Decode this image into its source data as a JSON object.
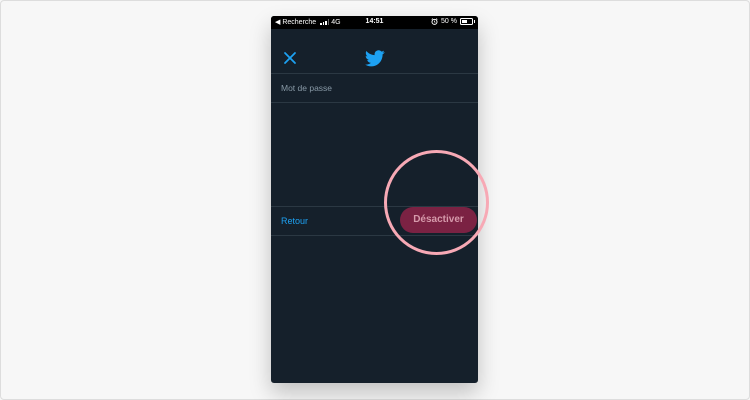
{
  "status_bar": {
    "back_label": "◀ Recherche",
    "network": "4G",
    "time": "14:51",
    "battery_label": "50 %",
    "battery_level": 0.5
  },
  "password_field": {
    "placeholder": "Mot de passe",
    "value": ""
  },
  "actions": {
    "back_label": "Retour",
    "deactivate_label": "Désactiver"
  },
  "colors": {
    "background": "#15202b",
    "accent": "#1da1f2",
    "deactivate_button": "#7b2243",
    "highlight": "#f7a9b5"
  },
  "icons": [
    "close-icon",
    "twitter-bird-icon",
    "signal-icon",
    "alarm-icon",
    "battery-icon"
  ]
}
